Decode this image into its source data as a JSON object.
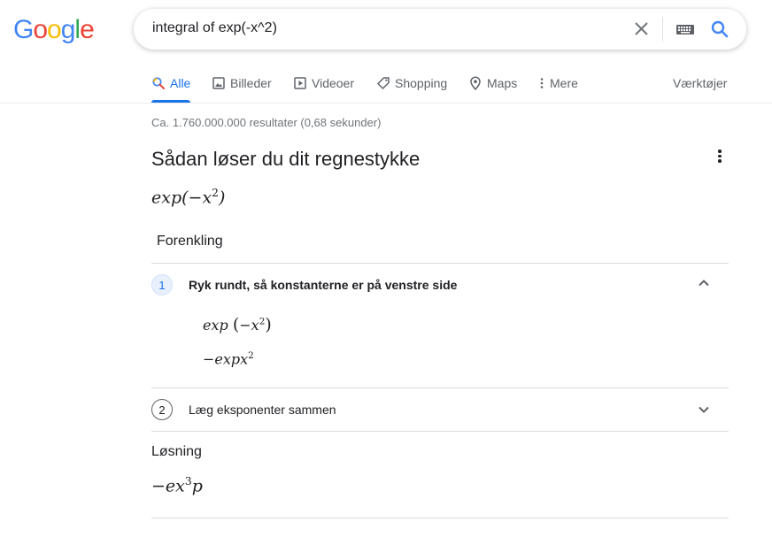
{
  "logo": {
    "letters": [
      "G",
      "o",
      "o",
      "g",
      "l",
      "e"
    ],
    "colors": [
      "#4285F4",
      "#EA4335",
      "#FBBC05",
      "#4285F4",
      "#34A853",
      "#EA4335"
    ]
  },
  "search": {
    "query": "integral of exp(-x^2)",
    "clear_icon": "close-icon",
    "keyboard_icon": "keyboard-icon",
    "search_icon": "search-icon"
  },
  "tabs": [
    {
      "label": "Alle",
      "icon": "search-icon",
      "active": true
    },
    {
      "label": "Billeder",
      "icon": "image-icon",
      "active": false
    },
    {
      "label": "Videoer",
      "icon": "video-icon",
      "active": false
    },
    {
      "label": "Shopping",
      "icon": "tag-icon",
      "active": false
    },
    {
      "label": "Maps",
      "icon": "map-pin-icon",
      "active": false
    },
    {
      "label": "Mere",
      "icon": "more-vert-icon",
      "active": false
    }
  ],
  "tools_label": "Værktøjer",
  "result_stats": "Ca. 1.760.000.000 resultater (0,68 sekunder)",
  "card": {
    "title": "Sådan løser du dit regnestykke",
    "problem": {
      "base": "exp(−x",
      "exp": "2",
      "tail": ")"
    },
    "section_label": "Forenkling",
    "steps": [
      {
        "number": "1",
        "title": "Ryk rundt, så konstanterne er på venstre side",
        "expanded": true,
        "lines": [
          {
            "base": "exp",
            "paren_open": "(",
            "inner": "−x",
            "exp": "2",
            "paren_close": ")"
          },
          {
            "base": "−expx",
            "exp": "2"
          }
        ]
      },
      {
        "number": "2",
        "title": "Læg eksponenter sammen",
        "expanded": false
      }
    ],
    "solution_label": "Løsning",
    "solution": {
      "pre": "−ex",
      "exp": "3",
      "post": "p"
    }
  },
  "colors": {
    "accent": "#1a73e8",
    "text": "#202124",
    "muted": "#5f6368"
  }
}
